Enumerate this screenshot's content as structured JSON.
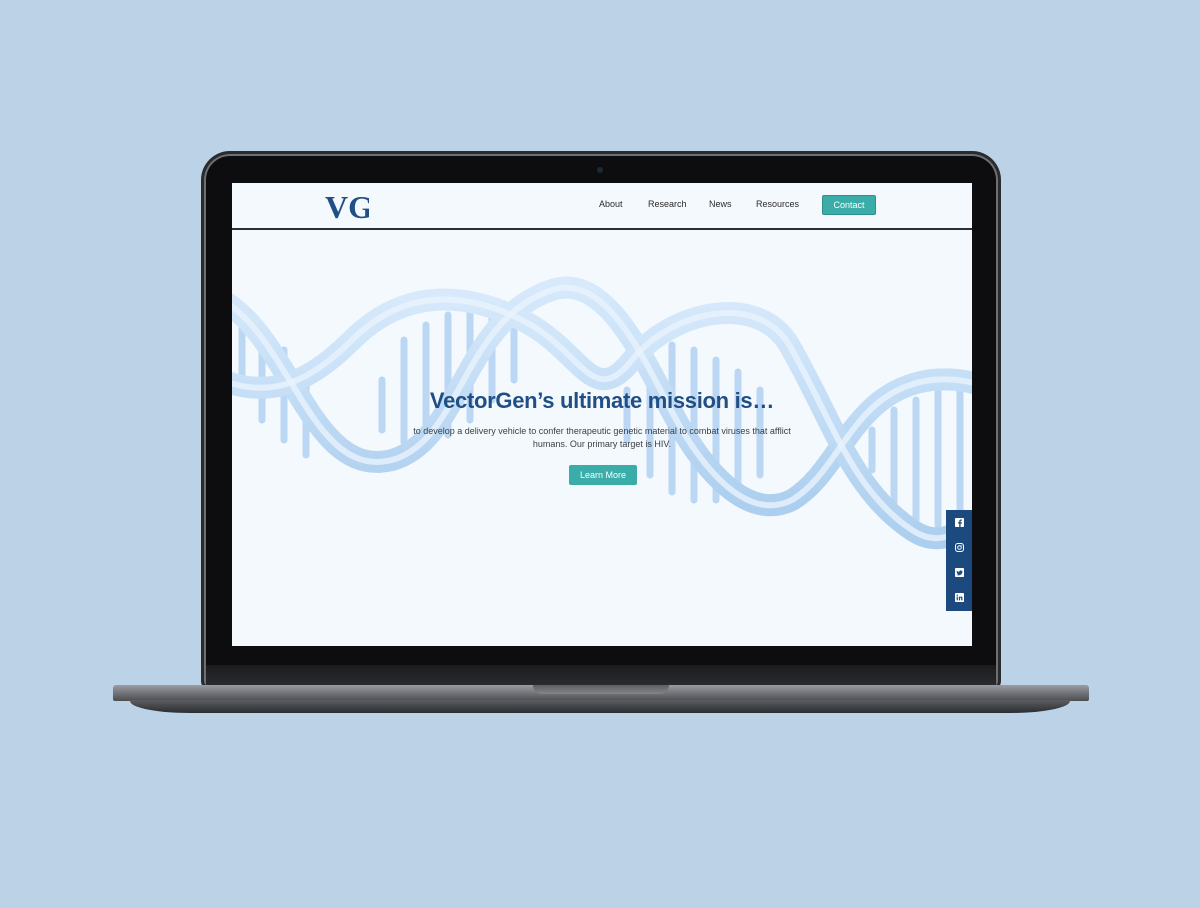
{
  "nav": {
    "logo_text": "VG",
    "links": [
      "About",
      "Research",
      "News",
      "Resources"
    ],
    "contact_label": "Contact"
  },
  "hero": {
    "title": "VectorGen’s ultimate mission is…",
    "text": "to develop a delivery vehicle to confer therapeutic genetic material to combat viruses that afflict humans. Our primary target is HIV.",
    "button_label": "Learn More"
  },
  "social": {
    "icons": [
      "facebook-icon",
      "instagram-icon",
      "twitter-icon",
      "linkedin-icon"
    ]
  },
  "colors": {
    "brand": "#1f4f85",
    "accent": "#3aada9",
    "page_bg": "#f4f9fe",
    "backdrop": "#bcd3e7"
  }
}
